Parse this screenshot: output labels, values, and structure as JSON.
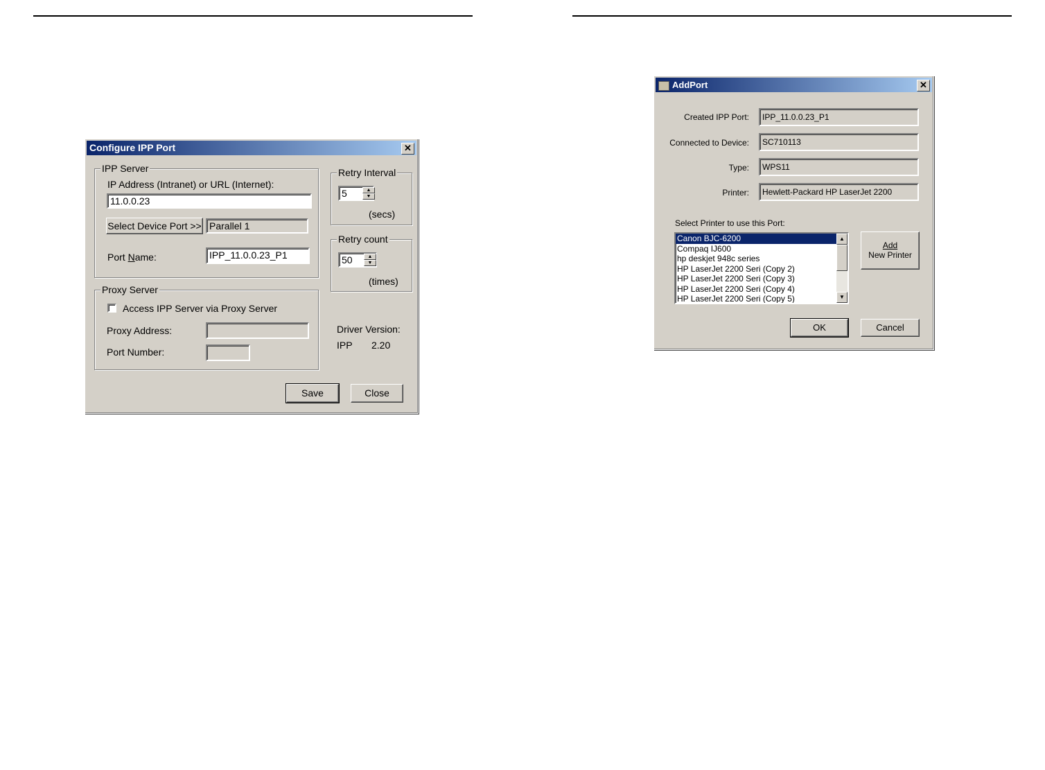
{
  "configure_ipp_port": {
    "title": "Configure IPP Port",
    "ipp_server": {
      "group_label": "IPP Server",
      "address_label": "IP Address (Intranet) or URL (Internet):",
      "address_value": "11.0.0.23",
      "select_device_port_label": "Select Device Port >>",
      "device_port_value": "Parallel 1",
      "port_name_label_pre": "Port ",
      "port_name_label_accel": "N",
      "port_name_label_post": "ame:",
      "port_name_value": "IPP_11.0.0.23_P1"
    },
    "retry_interval": {
      "group_label": "Retry Interval",
      "value": "5",
      "unit": "(secs)"
    },
    "retry_count": {
      "group_label": "Retry count",
      "value": "50",
      "unit": "(times)"
    },
    "proxy_server": {
      "group_label": "Proxy Server",
      "checkbox_label": "Access IPP Server via Proxy Server",
      "checked": false,
      "proxy_address_label": "Proxy Address:",
      "proxy_address_value": "",
      "port_number_label": "Port Number:",
      "port_number_value": ""
    },
    "driver_version": {
      "label": "Driver Version:",
      "name": "IPP",
      "version": "2.20"
    },
    "save_label": "Save",
    "close_label": "Close"
  },
  "add_port": {
    "title": "AddPort",
    "created_ipp_port_label": "Created IPP Port:",
    "created_ipp_port_value": "IPP_11.0.0.23_P1",
    "connected_to_device_label": "Connected to Device:",
    "connected_to_device_value": "SC710113",
    "type_label": "Type:",
    "type_value": "WPS11",
    "printer_label": "Printer:",
    "printer_value": "Hewlett-Packard HP LaserJet 2200",
    "select_printer_label": "Select Printer to use this Port:",
    "printers": [
      "Canon BJC-6200",
      "Compaq IJ600",
      "hp deskjet 948c series",
      "HP LaserJet 2200 Seri (Copy 2)",
      "HP LaserJet 2200 Seri (Copy 3)",
      "HP LaserJet 2200 Seri (Copy 4)",
      "HP LaserJet 2200 Seri (Copy 5)"
    ],
    "selected_printer_index": 0,
    "add_new_printer_line1": "Add",
    "add_new_printer_line2": "New Printer",
    "ok_label": "OK",
    "cancel_label": "Cancel"
  }
}
